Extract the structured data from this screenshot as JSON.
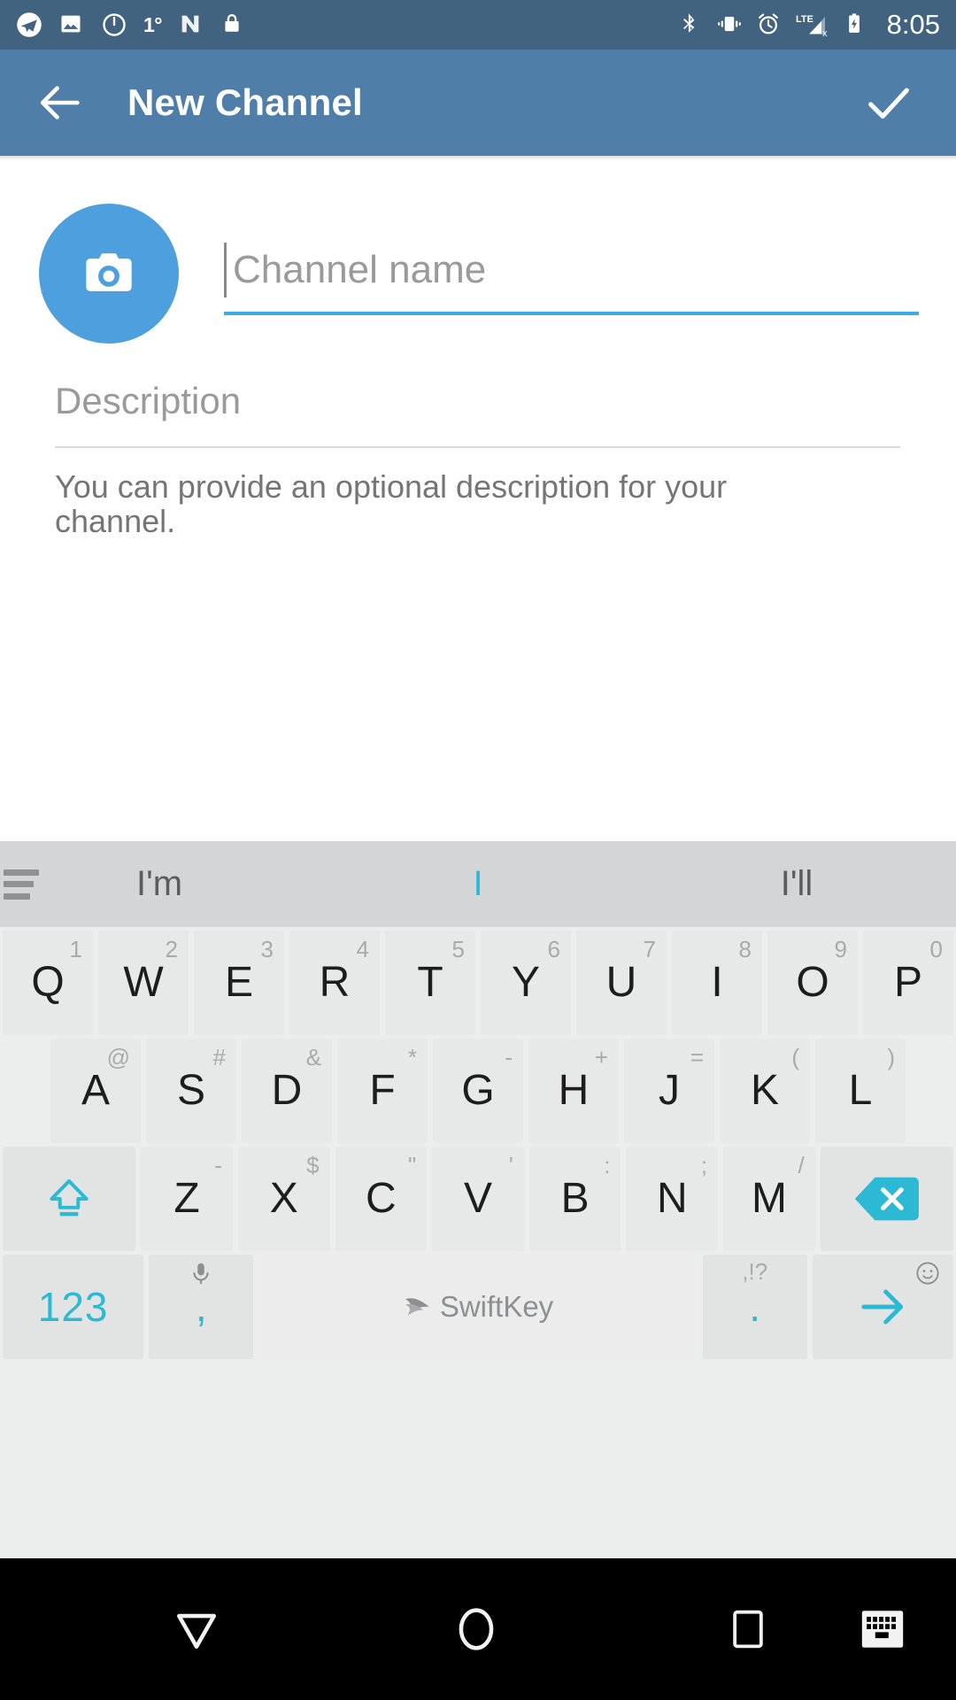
{
  "status_bar": {
    "background": "#41637f",
    "time": "8:05",
    "temperature": "1°",
    "left_icons": [
      "telegram-icon",
      "photo-icon",
      "clock-outline-icon",
      "temperature-label",
      "nova-launcher-icon",
      "lock-icon"
    ],
    "right_icons": [
      "bluetooth-icon",
      "vibrate-icon",
      "alarm-icon",
      "lte-signal-icon",
      "battery-charging-icon"
    ]
  },
  "app_bar": {
    "background": "#4f7fa8",
    "title": "New Channel",
    "back_icon": "arrow-back-icon",
    "done_icon": "check-icon"
  },
  "form": {
    "avatar": {
      "icon": "camera-icon",
      "background": "#4d9fdd"
    },
    "channel_name": {
      "value": "",
      "placeholder": "Channel name",
      "underline_color": "#3dabe6",
      "focused": true
    },
    "description": {
      "value": "",
      "placeholder": "Description",
      "underline_color": "#d8d8d8"
    },
    "description_hint": "You can provide an optional description for your channel."
  },
  "keyboard": {
    "background": "#eceded",
    "accent": "#2cb9d4",
    "suggestion_bar": {
      "menu_icon": "hamburger-menu-icon",
      "suggestions": [
        {
          "label": "I'm",
          "active": false
        },
        {
          "label": "I",
          "active": true
        },
        {
          "label": "I'll",
          "active": false
        }
      ]
    },
    "rows": [
      [
        {
          "letter": "Q",
          "alt": "1"
        },
        {
          "letter": "W",
          "alt": "2"
        },
        {
          "letter": "E",
          "alt": "3"
        },
        {
          "letter": "R",
          "alt": "4"
        },
        {
          "letter": "T",
          "alt": "5"
        },
        {
          "letter": "Y",
          "alt": "6"
        },
        {
          "letter": "U",
          "alt": "7"
        },
        {
          "letter": "I",
          "alt": "8"
        },
        {
          "letter": "O",
          "alt": "9"
        },
        {
          "letter": "P",
          "alt": "0"
        }
      ],
      [
        {
          "letter": "A",
          "alt": "@"
        },
        {
          "letter": "S",
          "alt": "#"
        },
        {
          "letter": "D",
          "alt": "&"
        },
        {
          "letter": "F",
          "alt": "*"
        },
        {
          "letter": "G",
          "alt": "-"
        },
        {
          "letter": "H",
          "alt": "+"
        },
        {
          "letter": "J",
          "alt": "="
        },
        {
          "letter": "K",
          "alt": "("
        },
        {
          "letter": "L",
          "alt": ")"
        }
      ],
      [
        {
          "letter": "Z",
          "alt": "-"
        },
        {
          "letter": "X",
          "alt": "$"
        },
        {
          "letter": "C",
          "alt": "\""
        },
        {
          "letter": "V",
          "alt": "'"
        },
        {
          "letter": "B",
          "alt": ":"
        },
        {
          "letter": "N",
          "alt": ";"
        },
        {
          "letter": "M",
          "alt": "/"
        }
      ]
    ],
    "shift_key": {
      "icon": "shift-caps-lock-icon"
    },
    "backspace_key": {
      "icon": "backspace-icon"
    },
    "bottom_row": {
      "numeric_key": "123",
      "comma_key": ",",
      "mic_alt_icon": "microphone-icon",
      "space_key_label": "SwiftKey",
      "space_key_icon": "swiftkey-logo-icon",
      "period_key": ".",
      "period_alt": ",!?",
      "emoji_alt_icon": "emoji-smiley-icon",
      "enter_icon": "arrow-right-icon"
    }
  },
  "nav_bar": {
    "background": "#000000",
    "back_icon": "nav-back-triangle-icon",
    "home_icon": "nav-home-circle-icon",
    "recents_icon": "nav-recents-square-icon",
    "keyboard_icon": "nav-hide-keyboard-icon"
  }
}
